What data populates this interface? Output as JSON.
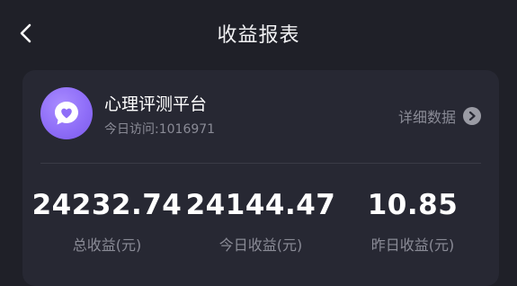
{
  "header": {
    "title": "收益报表",
    "back_icon": "chevron-left-icon"
  },
  "app": {
    "name": "心理评测平台",
    "visits": "今日访问:1016971",
    "icon": "heart-chat-icon",
    "icon_color": "#8f6ef8",
    "details_label": "详细数据",
    "details_icon": "chevron-right-circle-icon"
  },
  "stats": [
    {
      "value": "24232.74",
      "label": "总收益(元)"
    },
    {
      "value": "24144.47",
      "label": "今日收益(元)"
    },
    {
      "value": "10.85",
      "label": "昨日收益(元)"
    }
  ],
  "colors": {
    "background": "#1f2028",
    "card": "#272833",
    "muted_text": "#8a8b96"
  }
}
